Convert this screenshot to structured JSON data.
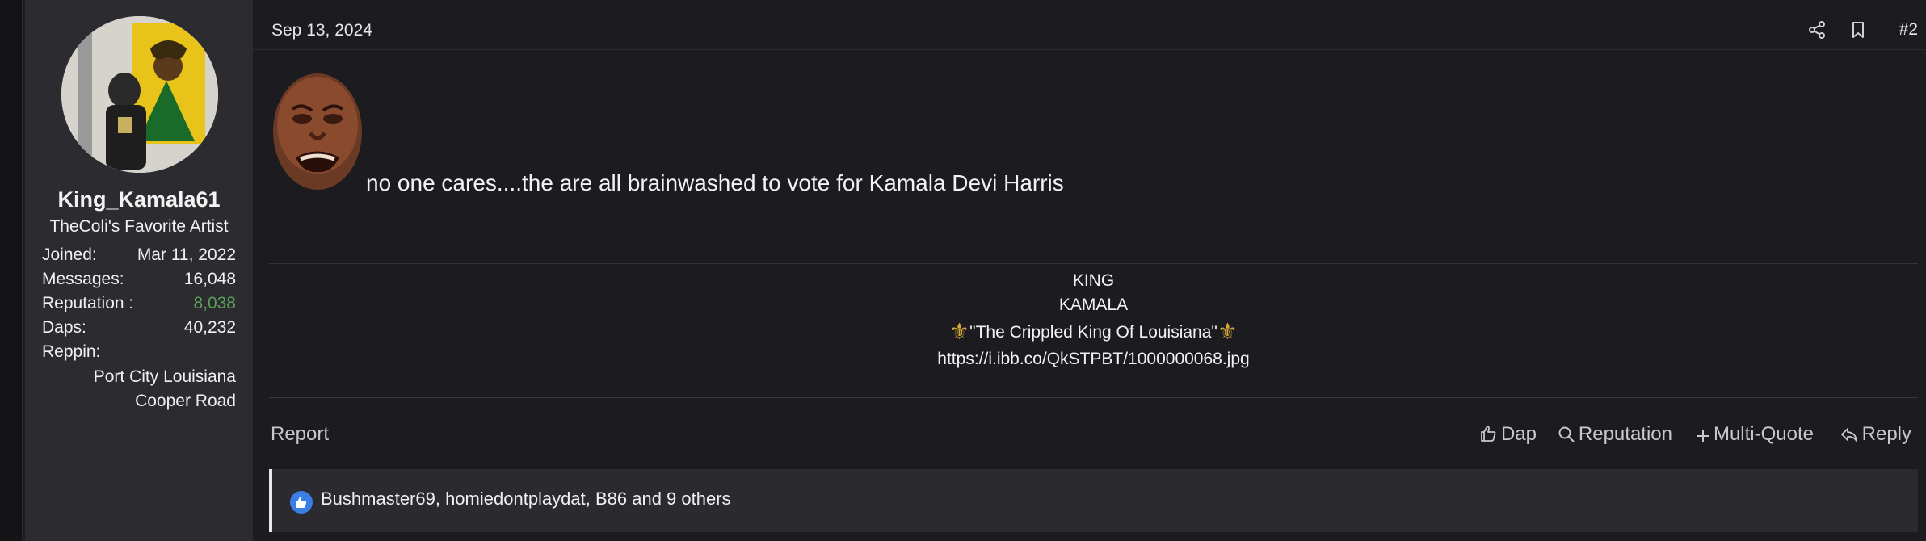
{
  "user": {
    "username": "King_Kamala61",
    "title": "TheColi's Favorite Artist",
    "stats": [
      {
        "label": "Joined:",
        "value": "Mar 11, 2022"
      },
      {
        "label": "Messages:",
        "value": "16,048"
      },
      {
        "label": "Reputation :",
        "value": "8,038"
      },
      {
        "label": "Daps:",
        "value": "40,232"
      },
      {
        "label": "Reppin:",
        "value": ""
      }
    ],
    "reppin_lines": [
      "Port City Louisiana",
      "Cooper Road"
    ]
  },
  "post": {
    "date": "Sep 13, 2024",
    "number": "#2",
    "message": "no one cares....the are all brainwashed to vote for Kamala Devi Harris"
  },
  "signature": {
    "line1": "KING",
    "line2": "KAMALA",
    "line3": "\"The Crippled King Of Louisiana\"",
    "fleur": "⚜",
    "link": "https://i.ibb.co/QkSTPBT/1000000068.jpg"
  },
  "actions": {
    "report": "Report",
    "dap": "Dap",
    "reputation": "Reputation",
    "multiquote": "Multi-Quote",
    "reply": "Reply"
  },
  "reactions": {
    "text": "Bushmaster69, homiedontplaydat, B86 and 9 others"
  },
  "colors": {
    "reputation_value": "#5aa05a",
    "like_icon": "#3a7ee6",
    "fleur": "#d4a83a"
  },
  "icons": [
    "share-icon",
    "bookmark-icon",
    "thumbs-up-icon",
    "search-icon",
    "plus-icon",
    "reply-icon",
    "like-reaction-icon"
  ]
}
